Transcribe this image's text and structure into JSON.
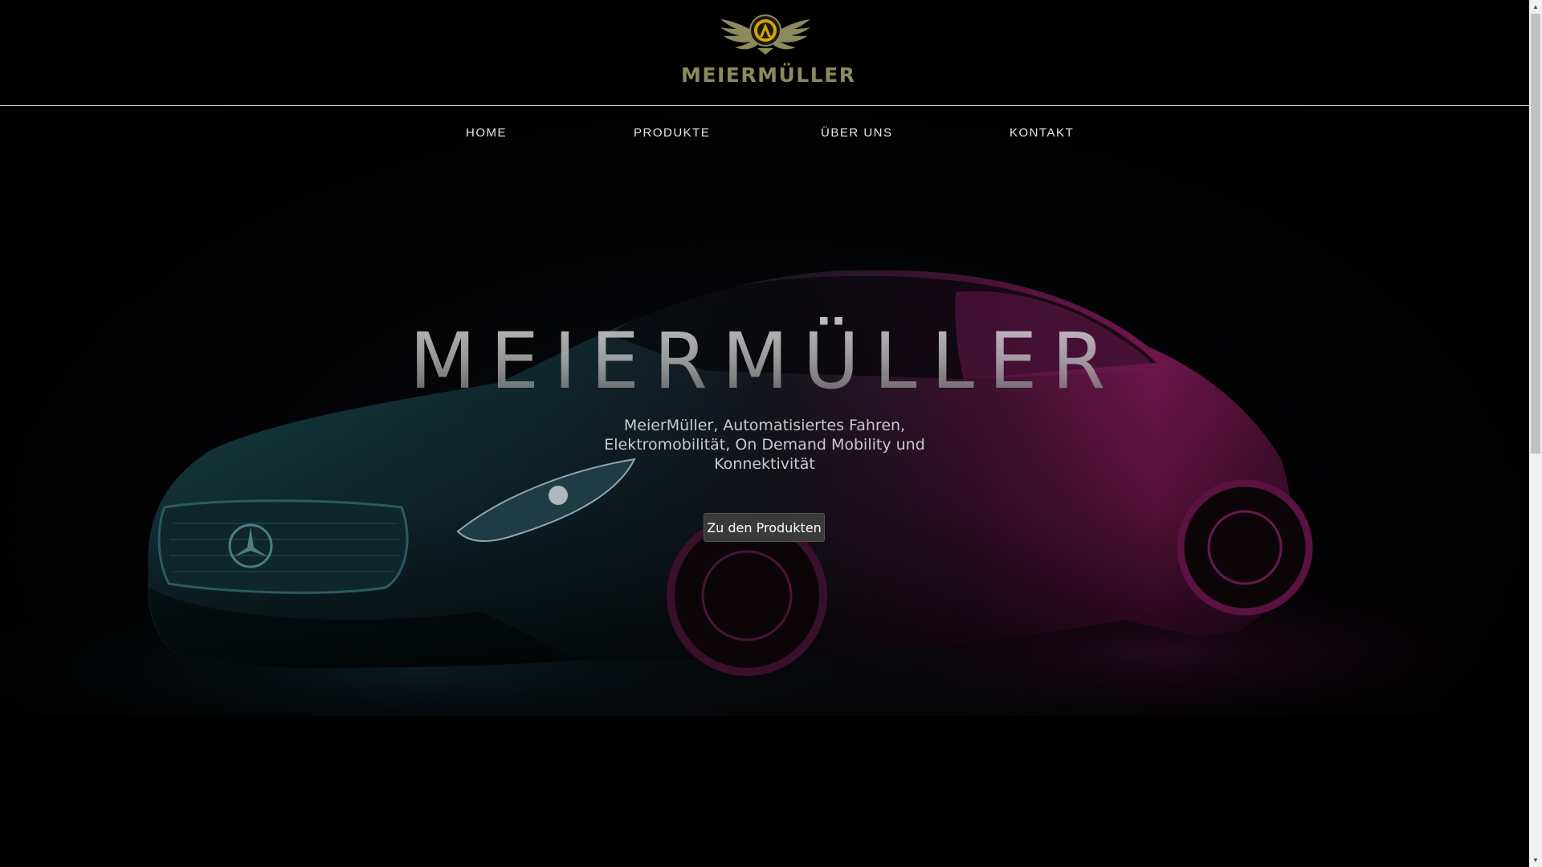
{
  "brand": {
    "logo_text": "MEIERMÜLLER",
    "logo_color": "#8a8a5c",
    "emblem_gold": "#d9a400"
  },
  "nav": {
    "items": [
      {
        "label": "HOME"
      },
      {
        "label": "PRODUKTE"
      },
      {
        "label": "ÜBER UNS"
      },
      {
        "label": "KONTAKT"
      }
    ]
  },
  "hero": {
    "title": "MEIERMÜLLER",
    "subtitle": "MeierMüller, Automatisiertes Fahren, Elektromobilität, On Demand Mobility und Konnektivität",
    "button_label": "Zu den Produkten",
    "car_colors": {
      "front": "#1d4a55",
      "rear": "#8a1a5e"
    }
  },
  "icons": {
    "emblem": "winged-crest-icon",
    "scroll_up": "chevron-up-icon",
    "scroll_down": "chevron-down-icon"
  }
}
